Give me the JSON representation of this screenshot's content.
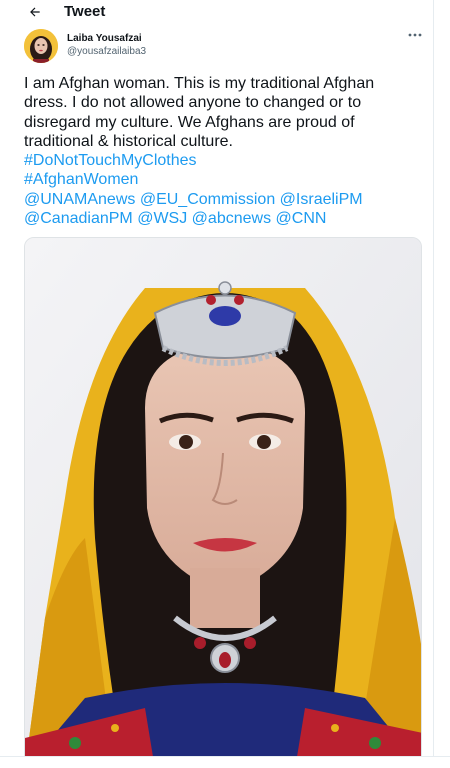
{
  "header": {
    "back_icon": "arrow-left-icon",
    "title": "Tweet"
  },
  "tweet": {
    "author": {
      "name": "Laiba Yousafzai",
      "handle": "@yousafzailaiba3",
      "avatar_icon": "profile-photo"
    },
    "more_icon": "more-dots-icon",
    "text_lines": [
      "I am Afghan woman. This is my traditional Afghan",
      "dress. I do not allowed anyone to changed or to",
      "disregard my culture. We Afghans are proud of",
      "traditional & historical culture."
    ],
    "hashtags": [
      "#DoNotTouchMyClothes",
      "#AfghanWomen"
    ],
    "mentions_line1": [
      "@UNAMAnews",
      "@EU_Commission",
      "@IsraeliPM"
    ],
    "mentions_line2": [
      "@CanadianPM",
      "@WSJ",
      "@abcnews",
      "@CNN"
    ],
    "media": {
      "type": "photo",
      "subject": "woman in traditional Afghan dress"
    }
  },
  "colors": {
    "link": "#1d9bf0",
    "text": "#0f1419",
    "secondary": "#536471",
    "border": "#dfe3e6"
  }
}
